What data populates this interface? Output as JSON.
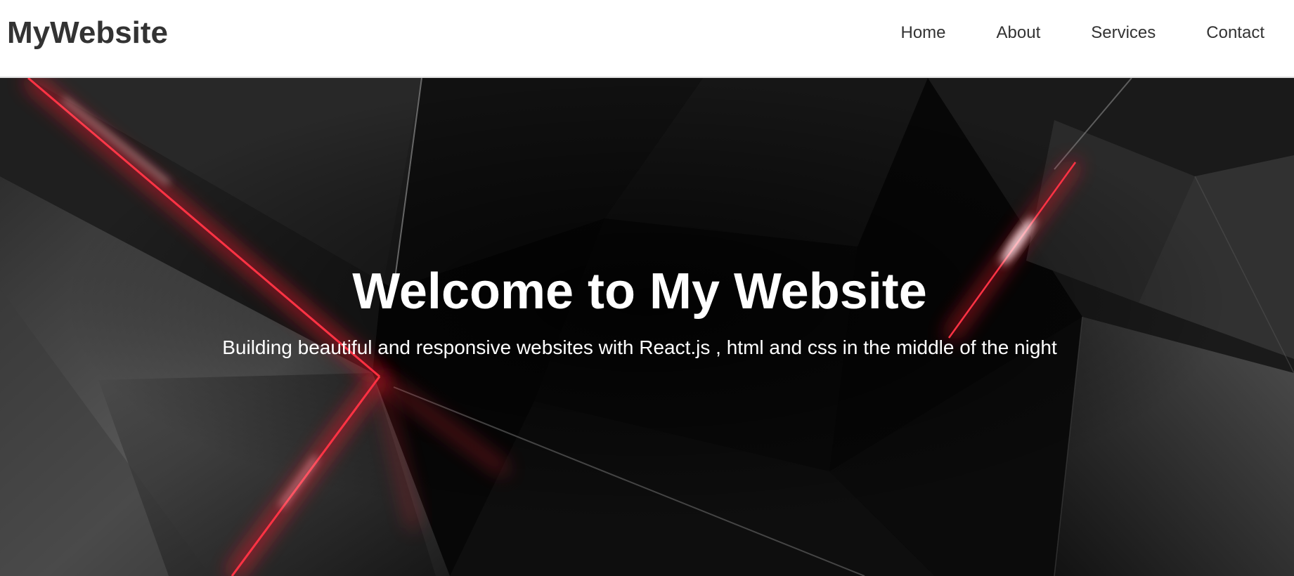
{
  "header": {
    "brand": "MyWebsite",
    "nav": [
      {
        "label": "Home"
      },
      {
        "label": "About"
      },
      {
        "label": "Services"
      },
      {
        "label": "Contact"
      }
    ]
  },
  "hero": {
    "title": "Welcome to My Website",
    "subtitle": "Building beautiful and responsive websites with React.js , html and css in the middle of the night"
  },
  "colors": {
    "header_background": "#ffffff",
    "header_text": "#333333",
    "hero_background": "#050505",
    "hero_accent": "#ff1a2e",
    "hero_text": "#ffffff"
  }
}
